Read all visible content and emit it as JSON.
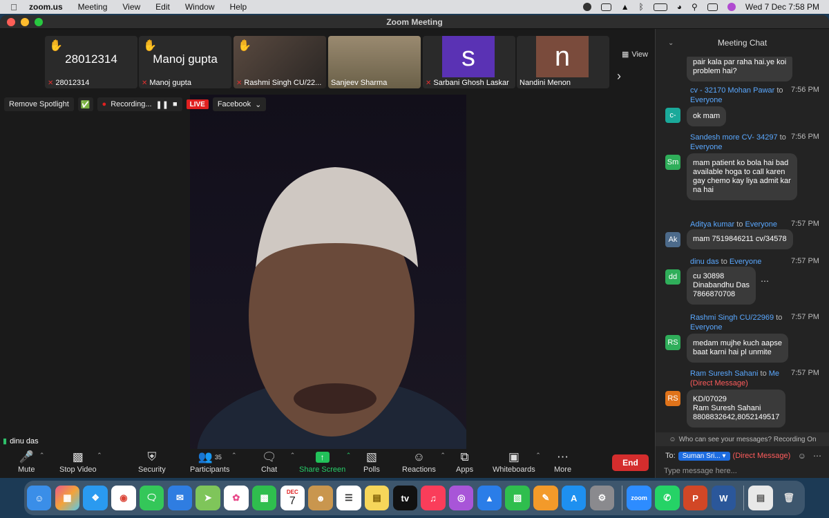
{
  "menubar": {
    "app_name": "zoom.us",
    "items": [
      "Meeting",
      "View",
      "Edit",
      "Window",
      "Help"
    ],
    "datetime": "Wed 7 Dec  7:58 PM"
  },
  "window": {
    "title": "Zoom Meeting"
  },
  "gallery": {
    "view_label": "View",
    "tiles": [
      {
        "big": "28012314",
        "label": "28012314",
        "hand": true,
        "muted": true
      },
      {
        "big": "Manoj gupta",
        "label": "Manoj gupta",
        "hand": true,
        "muted": true
      },
      {
        "big": "",
        "label": "Rashmi Singh CU/22...",
        "hand": true,
        "muted": true
      },
      {
        "big": "",
        "label": "Sanjeev Sharma",
        "hand": false,
        "muted": false
      },
      {
        "big": "",
        "avatar": "s",
        "avatar_color": "#5a32b4",
        "label": "Sarbani Ghosh Laskar",
        "hand": false,
        "muted": true
      },
      {
        "big": "",
        "avatar": "n",
        "avatar_color": "#7a4b3c",
        "label": "Nandini Menon",
        "hand": false,
        "muted": false
      }
    ]
  },
  "spotlight_bar": {
    "remove_spotlight": "Remove Spotlight",
    "recording": "Recording...",
    "live": "LIVE",
    "stream_target": "Facebook"
  },
  "main_video": {
    "name": "dinu das"
  },
  "controls": {
    "mute": "Mute",
    "stop_video": "Stop Video",
    "security": "Security",
    "participants": "Participants",
    "participants_count": "35",
    "chat": "Chat",
    "share_screen": "Share Screen",
    "polls": "Polls",
    "reactions": "Reactions",
    "apps": "Apps",
    "whiteboards": "Whiteboards",
    "more": "More",
    "end": "End"
  },
  "chat": {
    "title": "Meeting Chat",
    "messages": [
      {
        "text": "pair kala par raha hai.ye koi\nproblem hai?"
      },
      {
        "sender": "cv - 32170 Mohan Pawar",
        "to_word": "to",
        "recipient": "Everyone",
        "time": "7:56 PM",
        "avatar": "c-",
        "avatar_color": "#1aa99a",
        "text": "ok mam"
      },
      {
        "sender": "Sandesh more CV- 34297",
        "to_word": "to",
        "recipient": "Everyone",
        "time": "7:56 PM",
        "avatar": "Sm",
        "avatar_color": "#2fae5a",
        "text": "mam patient ko bola hai bad\navailable hoga to call karen\ngay chemo kay liya admit kar\nna hai"
      },
      {
        "sender": "Aditya kumar",
        "to_word": "to",
        "recipient": "Everyone",
        "time": "7:57 PM",
        "avatar": "Ak",
        "avatar_color": "#4c6a8a",
        "text": "mam 7519846211 cv/34578"
      },
      {
        "sender": "dinu das",
        "to_word": "to",
        "recipient": "Everyone",
        "time": "7:57 PM",
        "avatar": "dd",
        "avatar_color": "#2fae5a",
        "text": "cu 30898\nDinabandhu Das\n7866870708"
      },
      {
        "sender": "Rashmi Singh CU/22969",
        "to_word": "to",
        "recipient": "Everyone",
        "time": "7:57 PM",
        "avatar": "RS",
        "avatar_color": "#2fae5a",
        "text": "medam mujhe kuch aapse\nbaat karni hai pl unmite"
      },
      {
        "sender": "Ram Suresh Sahani",
        "to_word": "to",
        "recipient": "Me",
        "direct": "(Direct Message)",
        "time": "7:57 PM",
        "avatar": "RS",
        "avatar_color": "#e0731a",
        "text": "KD/07029\n Ram Suresh Sahani\n8808832642,8052149517"
      }
    ],
    "who_can_see": "Who can see your messages? Recording On",
    "to_label": "To:",
    "to_selected": "Suman Sri...",
    "to_direct": "(Direct Message)",
    "input_placeholder": "Type message here..."
  },
  "dock": {
    "calendar_month": "DEC",
    "calendar_day": "7",
    "zoom_label": "zoom"
  },
  "colors": {
    "accent_blue": "#5aa8ff",
    "end_red": "#d42d2d",
    "share_green": "#22c25a",
    "live_red": "#e02020"
  }
}
